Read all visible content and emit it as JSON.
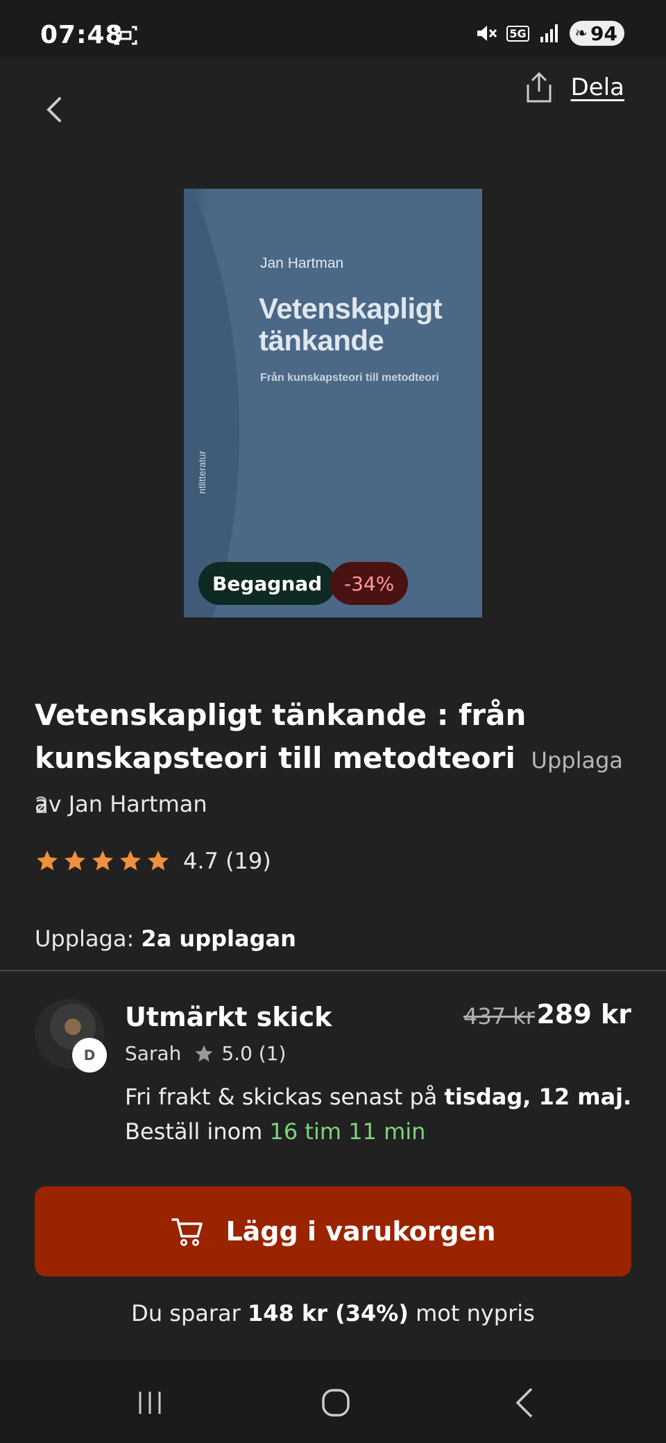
{
  "status_bar": {
    "time": "07:48",
    "battery": "94",
    "network": "5G"
  },
  "header": {
    "share_label": "Dela"
  },
  "cover": {
    "author": "Jan Hartman",
    "title": "Vetenskapligt tänkande",
    "subtitle": "Från kunskapsteori till metodteori",
    "spine": "ntlitteratur",
    "badge_used": "Begagnad",
    "badge_discount": "-34%"
  },
  "product": {
    "title": "Vetenskapligt tänkande : från kunskapsteori till metodteori",
    "edition_inline": "Upplaga 2",
    "author": "av Jan Hartman",
    "rating": "4.7 (19)",
    "stars": 5,
    "edition_label": "Upplaga:",
    "edition_value": "2a upplagan"
  },
  "offer": {
    "condition": "Utmärkt skick",
    "old_price": "437 kr",
    "new_price": "289 kr",
    "seller_name": "Sarah",
    "seller_rating": "5.0 (1)",
    "avatar_badge": "D",
    "shipping_prefix": "Fri frakt & skickas senast på",
    "shipping_date": "tisdag, 12 maj.",
    "deadline_prefix": "Beställ inom",
    "deadline_time": "16 tim 11 min"
  },
  "cart_button": {
    "label": "Lägg i varukorgen"
  },
  "savings": {
    "prefix": "Du sparar",
    "amount": "148 kr (34%)",
    "suffix": "mot nypris"
  },
  "colors": {
    "accent": "#9a2400",
    "star": "#f0903a",
    "green": "#7ed37e",
    "background": "#212121"
  },
  "icons": [
    "screenshot-icon",
    "mute-icon",
    "signal-icon",
    "battery-icon",
    "back-icon",
    "share-icon",
    "star-icon",
    "cart-icon",
    "nav-recents-icon",
    "nav-home-icon",
    "nav-back-icon"
  ]
}
